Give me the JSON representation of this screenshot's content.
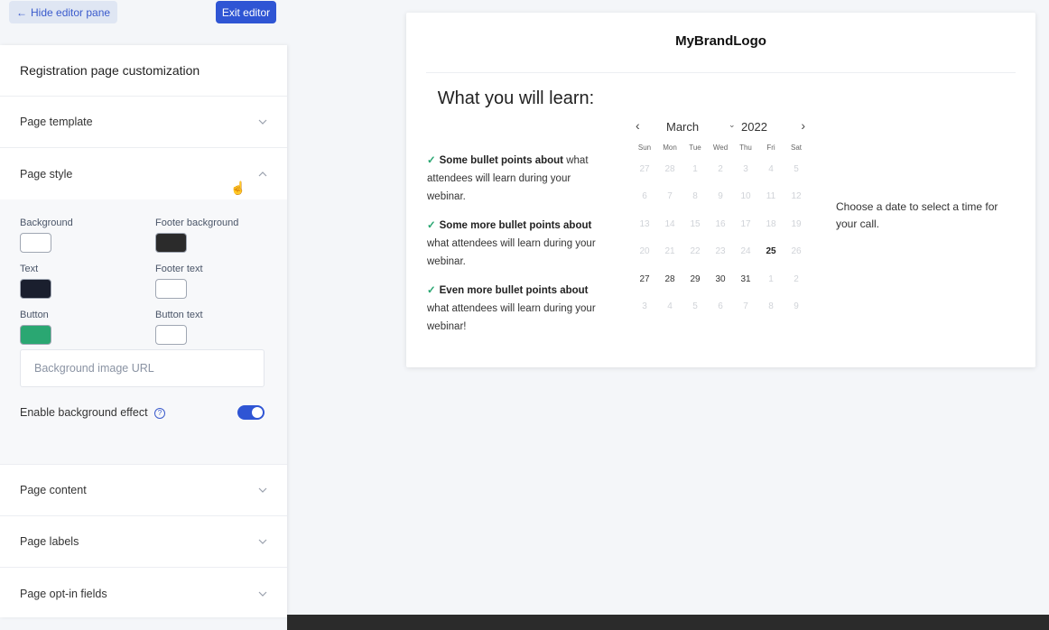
{
  "toolbar": {
    "hide_label": "Hide editor pane",
    "exit_label": "Exit editor"
  },
  "pane": {
    "title": "Registration page customization",
    "sections": {
      "template": "Page template",
      "style": "Page style",
      "content": "Page content",
      "labels": "Page labels",
      "optin": "Page opt-in fields"
    }
  },
  "style": {
    "swatches": [
      {
        "label": "Background",
        "color": "#ffffff"
      },
      {
        "label": "Footer background",
        "color": "#2b2b2b"
      },
      {
        "label": "Text",
        "color": "#1a1f2e"
      },
      {
        "label": "Footer text",
        "color": "#ffffff"
      },
      {
        "label": "Button",
        "color": "#2aa772"
      },
      {
        "label": "Button text",
        "color": "#ffffff"
      }
    ],
    "bg_url_placeholder": "Background image URL",
    "effect_label": "Enable background effect",
    "effect_enabled": true
  },
  "preview": {
    "brand": "MyBrandLogo",
    "learn_title": "What you will learn:",
    "bullets": [
      {
        "bold": "Some bullet points about",
        "rest": "what attendees will learn during your webinar."
      },
      {
        "bold": "Some more bullet points about",
        "rest": "what attendees will learn during your webinar."
      },
      {
        "bold": "Even more bullet points about",
        "rest": "what attendees will learn during your webinar!"
      }
    ],
    "calendar": {
      "month": "March",
      "year": "2022",
      "weekdays": [
        "Sun",
        "Mon",
        "Tue",
        "Wed",
        "Thu",
        "Fri",
        "Sat"
      ],
      "days": [
        {
          "d": "27",
          "s": "off"
        },
        {
          "d": "28",
          "s": "off"
        },
        {
          "d": "1",
          "s": "off"
        },
        {
          "d": "2",
          "s": "off"
        },
        {
          "d": "3",
          "s": "off"
        },
        {
          "d": "4",
          "s": "off"
        },
        {
          "d": "5",
          "s": "off"
        },
        {
          "d": "6",
          "s": "off"
        },
        {
          "d": "7",
          "s": "off"
        },
        {
          "d": "8",
          "s": "off"
        },
        {
          "d": "9",
          "s": "off"
        },
        {
          "d": "10",
          "s": "off"
        },
        {
          "d": "11",
          "s": "off"
        },
        {
          "d": "12",
          "s": "off"
        },
        {
          "d": "13",
          "s": "off"
        },
        {
          "d": "14",
          "s": "off"
        },
        {
          "d": "15",
          "s": "off"
        },
        {
          "d": "16",
          "s": "off"
        },
        {
          "d": "17",
          "s": "off"
        },
        {
          "d": "18",
          "s": "off"
        },
        {
          "d": "19",
          "s": "off"
        },
        {
          "d": "20",
          "s": "off"
        },
        {
          "d": "21",
          "s": "off"
        },
        {
          "d": "22",
          "s": "off"
        },
        {
          "d": "23",
          "s": "off"
        },
        {
          "d": "24",
          "s": "off"
        },
        {
          "d": "25",
          "s": "selected"
        },
        {
          "d": "26",
          "s": "off"
        },
        {
          "d": "27",
          "s": "active"
        },
        {
          "d": "28",
          "s": "active"
        },
        {
          "d": "29",
          "s": "active"
        },
        {
          "d": "30",
          "s": "active"
        },
        {
          "d": "31",
          "s": "active"
        },
        {
          "d": "1",
          "s": "off"
        },
        {
          "d": "2",
          "s": "off"
        },
        {
          "d": "3",
          "s": "off"
        },
        {
          "d": "4",
          "s": "off"
        },
        {
          "d": "5",
          "s": "off"
        },
        {
          "d": "6",
          "s": "off"
        },
        {
          "d": "7",
          "s": "off"
        },
        {
          "d": "8",
          "s": "off"
        },
        {
          "d": "9",
          "s": "off"
        }
      ]
    },
    "choose_text": "Choose a date to select a time for your call."
  },
  "colors": {
    "accent": "#2f55d4",
    "check": "#2aa772",
    "footer": "#2b2b2b"
  },
  "icons": {
    "back": "arrow-left-icon",
    "chevron_down": "chevron-down-icon",
    "chevron_up": "chevron-up-icon",
    "help": "help-circle-icon",
    "prev": "chevron-left-icon",
    "next": "chevron-right-icon"
  }
}
